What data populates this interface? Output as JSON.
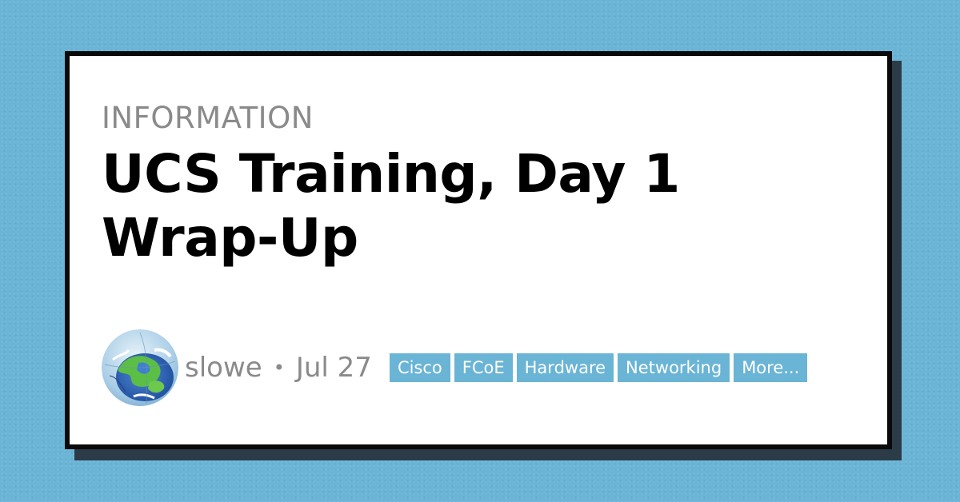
{
  "post": {
    "category": "INFORMATION",
    "title_line1": "UCS Training, Day 1",
    "title_line2": "Wrap-Up"
  },
  "byline": {
    "author": "slowe",
    "separator": "•",
    "date": "Jul 27"
  },
  "tags": [
    "Cisco",
    "FCoE",
    "Hardware",
    "Networking",
    "More..."
  ],
  "colors": {
    "background": "#6ab4d6",
    "card": "#ffffff",
    "card_border": "#0a0a0a",
    "card_shadow": "#2b3b47",
    "tag_bg": "#6ab4d6",
    "muted_text": "#8a8a8a"
  },
  "icons": {
    "avatar": "globe-avatar"
  }
}
